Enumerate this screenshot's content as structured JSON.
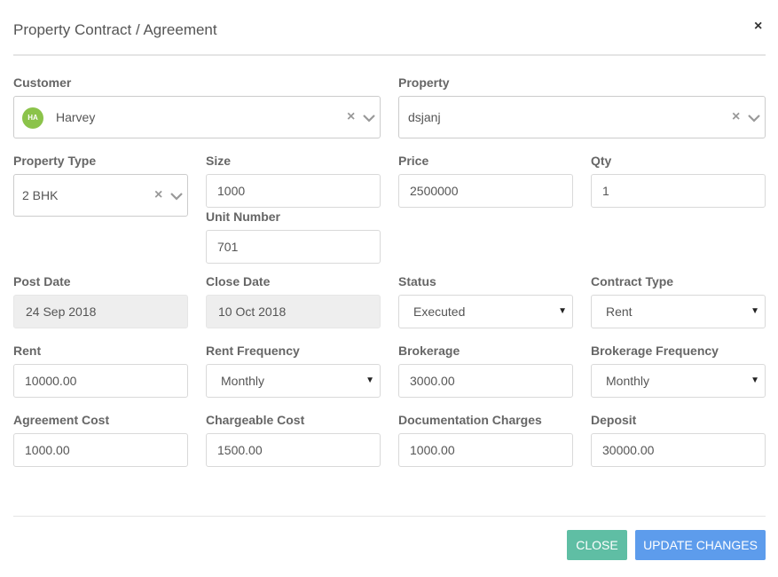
{
  "modal": {
    "title": "Property Contract / Agreement",
    "close_symbol": "×"
  },
  "customer": {
    "label": "Customer",
    "avatar_initials": "HA",
    "value": "Harvey",
    "avatar_color": "#8bc34a"
  },
  "property": {
    "label": "Property",
    "value": "dsjanj"
  },
  "property_type": {
    "label": "Property Type",
    "value": "2 BHK"
  },
  "size": {
    "label": "Size",
    "value": "1000"
  },
  "unit_number": {
    "label": "Unit Number",
    "value": "701"
  },
  "price": {
    "label": "Price",
    "value": "2500000"
  },
  "qty": {
    "label": "Qty",
    "value": "1"
  },
  "post_date": {
    "label": "Post Date",
    "value": "24 Sep 2018"
  },
  "close_date": {
    "label": "Close Date",
    "value": "10 Oct 2018"
  },
  "status": {
    "label": "Status",
    "value": "Executed"
  },
  "contract_type": {
    "label": "Contract Type",
    "value": "Rent"
  },
  "rent": {
    "label": "Rent",
    "value": "10000.00"
  },
  "rent_frequency": {
    "label": "Rent Frequency",
    "value": "Monthly"
  },
  "brokerage": {
    "label": "Brokerage",
    "value": "3000.00"
  },
  "brokerage_frequency": {
    "label": "Brokerage Frequency",
    "value": "Monthly"
  },
  "agreement_cost": {
    "label": "Agreement Cost",
    "value": "1000.00"
  },
  "chargeable_cost": {
    "label": "Chargeable Cost",
    "value": "1500.00"
  },
  "documentation_charges": {
    "label": "Documentation Charges",
    "value": "1000.00"
  },
  "deposit": {
    "label": "Deposit",
    "value": "30000.00"
  },
  "buttons": {
    "close": "CLOSE",
    "update": "UPDATE CHANGES"
  },
  "icons": {
    "clear": "×",
    "select_caret": "▼"
  },
  "colors": {
    "close_button": "#5fbea4",
    "update_button": "#5d9cec"
  }
}
